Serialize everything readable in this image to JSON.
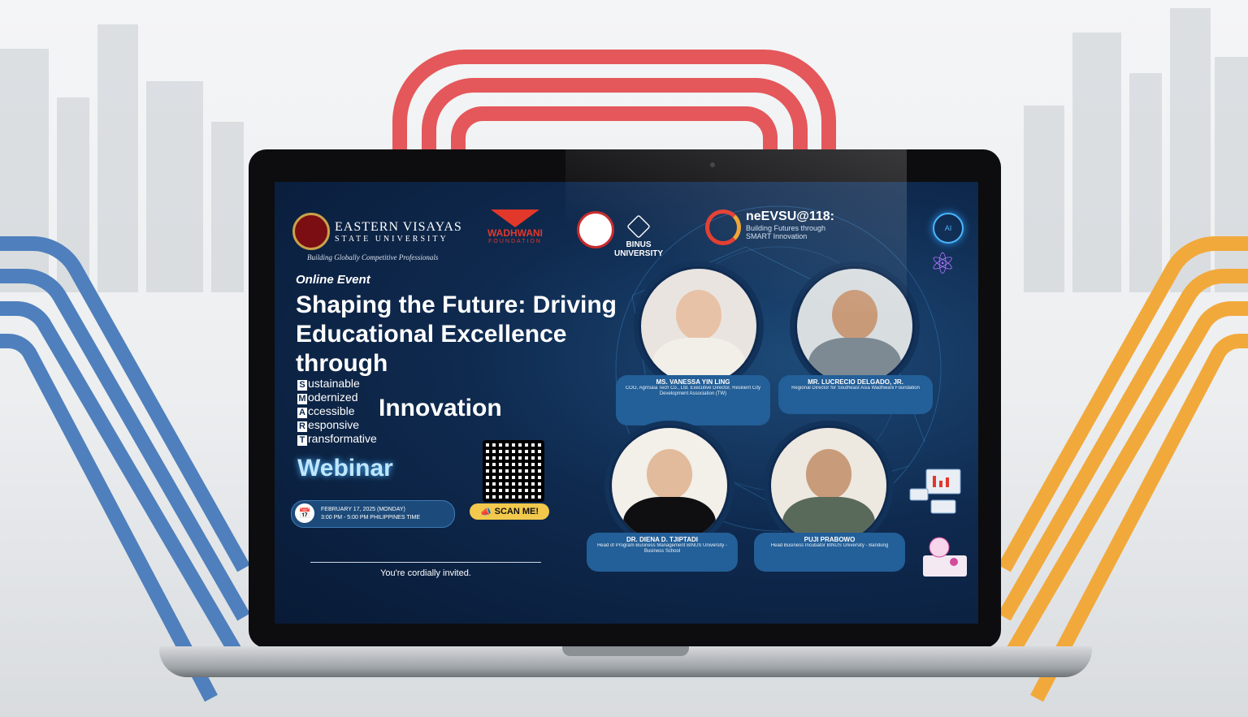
{
  "header": {
    "evsu_name": "EASTERN VISAYAS",
    "evsu_sub": "STATE UNIVERSITY",
    "evsu_tagline": "Building Globally Competitive Professionals",
    "wadhwani_name": "WADHWANI",
    "wadhwani_sub": "FOUNDATION",
    "binus_name": "BINUS UNIVERSITY",
    "event_brand": "neEVSU@118:",
    "event_brand_sub": "Building Futures through SMART Innovation",
    "ai_label": "AI"
  },
  "event": {
    "type": "Online Event",
    "title": "Shaping the Future: Driving Educational Excellence through",
    "smart": [
      {
        "letter": "S",
        "rest": "ustainable"
      },
      {
        "letter": "M",
        "rest": "odernized"
      },
      {
        "letter": "A",
        "rest": "ccessible"
      },
      {
        "letter": "R",
        "rest": "esponsive"
      },
      {
        "letter": "T",
        "rest": "ransformative"
      }
    ],
    "innovation": "Innovation",
    "format": "Webinar",
    "date": "FEBRUARY 17, 2025 (MONDAY)",
    "time": "3:00 PM - 5:00 PM PHILIPPINES TIME",
    "scan_label": "SCAN ME!",
    "invite": "You're cordially invited."
  },
  "speakers": [
    {
      "name": "MS. VANESSA YIN LING",
      "role": "COO, AgriSaia Tech Co., Ltd. Executive Director, Resilient City Development Association (TW)"
    },
    {
      "name": "MR. LUCRECIO DELGADO, JR.",
      "role": "Regional Director for Southeast Asia Wadhwani Foundation"
    },
    {
      "name": "DR. DIENA D. TJIPTADI",
      "role": "Head of Program Business Management BINUS University - Business School"
    },
    {
      "name": "PUJI PRABOWO",
      "role": "Head Business Incubator BINUS University - Bandung"
    }
  ],
  "colors": {
    "arc_red": "#e4575a",
    "arc_blue": "#4f80bd",
    "arc_orange": "#f2a93b",
    "screen_bg": "#0f2a4f",
    "card": "#235f98"
  }
}
